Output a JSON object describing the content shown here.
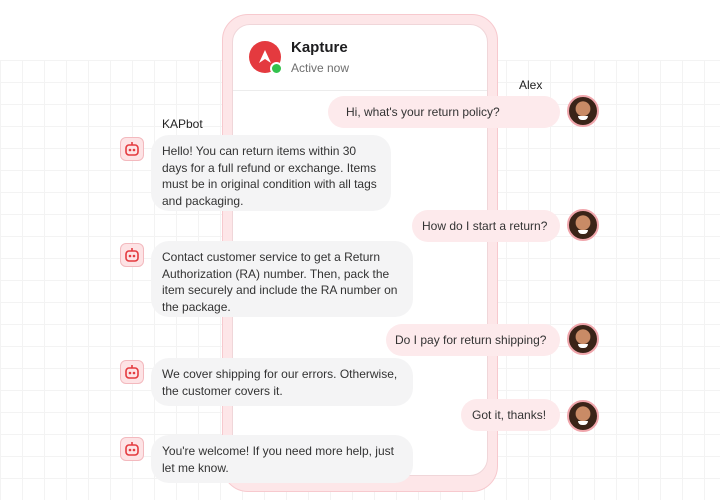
{
  "app": {
    "name": "Kapture",
    "status": "Active now"
  },
  "participants": {
    "user_name": "Alex",
    "bot_name": "KAPbot"
  },
  "messages": [
    {
      "from": "user",
      "text": "Hi, what's your return policy?"
    },
    {
      "from": "bot",
      "text": "Hello! You can return items within 30 days for a full refund or exchange. Items must be in original condition with all tags and packaging."
    },
    {
      "from": "user",
      "text": "How do I start a return?"
    },
    {
      "from": "bot",
      "text": "Contact customer service to get a Return Authorization (RA) number. Then, pack the item securely and include the RA number on the package."
    },
    {
      "from": "user",
      "text": "Do I pay for return shipping?"
    },
    {
      "from": "bot",
      "text": "We cover shipping for our errors. Otherwise, the customer covers it."
    },
    {
      "from": "user",
      "text": "Got it, thanks!"
    },
    {
      "from": "bot",
      "text": "You're welcome! If you need more help, just let me know."
    }
  ],
  "icons": {
    "brand_logo": "kapture-logo",
    "online": "online-status-dot",
    "bot": "robot-icon",
    "user": "user-avatar"
  },
  "colors": {
    "brand": "#e43a3f",
    "user_bubble": "#fdeaec",
    "bot_bubble": "#f4f4f5",
    "online": "#33c24d",
    "phone_frame": "#fde6e8"
  }
}
